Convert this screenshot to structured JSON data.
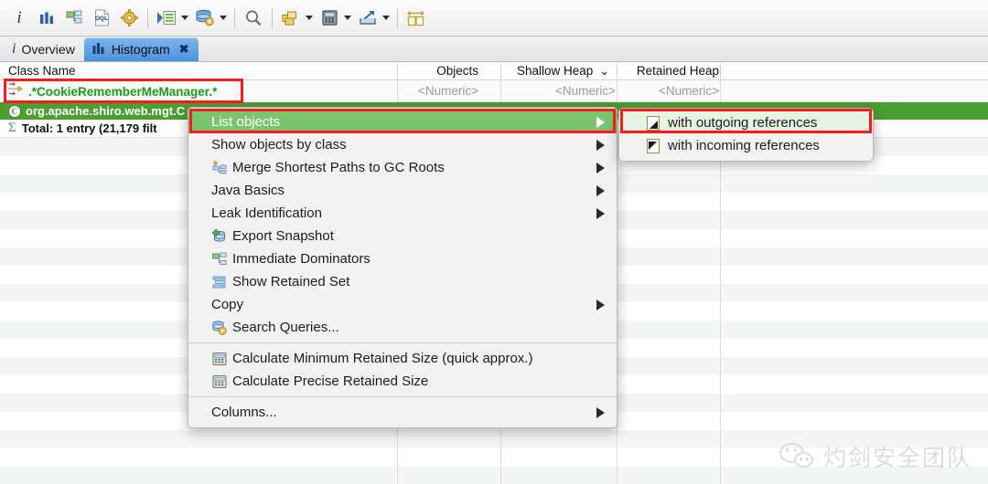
{
  "toolbar": {
    "buttons": [
      {
        "name": "info-icon",
        "label": "i"
      },
      {
        "name": "histogram-icon",
        "label": "Histogram"
      },
      {
        "name": "dominator-tree-icon",
        "label": "Dominator Tree"
      },
      {
        "name": "oql-icon",
        "label": "OQL"
      },
      {
        "name": "thread-overview-icon",
        "label": "Thread Overview"
      },
      {
        "name": "run-expert-system-icon",
        "label": "Run Expert System Test"
      },
      {
        "name": "query-browser-icon",
        "label": "Query Browser"
      },
      {
        "name": "find-icon",
        "label": "Find"
      },
      {
        "name": "group-by-icon",
        "label": "Group By"
      },
      {
        "name": "calculator-icon",
        "label": "Calculate Retained Size"
      },
      {
        "name": "export-icon",
        "label": "Export"
      },
      {
        "name": "compare-icon",
        "label": "Compare"
      }
    ]
  },
  "tabs": [
    {
      "label": "Overview",
      "icon": "info-icon",
      "active": false,
      "closable": false
    },
    {
      "label": "Histogram",
      "icon": "histogram-icon",
      "active": true,
      "closable": true
    }
  ],
  "table": {
    "columns": [
      {
        "label": "Class Name",
        "align": "left"
      },
      {
        "label": "Objects",
        "align": "right"
      },
      {
        "label": "Shallow Heap",
        "align": "right",
        "sort_indicator": "⌄"
      },
      {
        "label": "Retained Heap",
        "align": "right"
      }
    ],
    "filter_row": {
      "class_name": "",
      "objects": "<Numeric>",
      "shallow_heap": "<Numeric>",
      "retained_heap": "<Numeric>"
    },
    "regex_row": {
      "text": ".*CookieRememberMeManager.*",
      "icon": "regex-filter-icon"
    },
    "selected_row": {
      "text": "org.apache.shiro.web.mgt.C",
      "icon": "class-icon"
    },
    "total_row": {
      "text": "Total: 1 entry (21,179 filt",
      "icon": "sum-icon"
    }
  },
  "context_menu": {
    "items": [
      {
        "label": "List objects",
        "icon": null,
        "submenu": true,
        "highlighted": true
      },
      {
        "label": "Show objects by class",
        "icon": null,
        "submenu": true,
        "highlighted": false
      },
      {
        "label": "Merge Shortest Paths to GC Roots",
        "icon": "gc-roots-icon",
        "submenu": true,
        "highlighted": false
      },
      {
        "label": "Java Basics",
        "icon": null,
        "submenu": true,
        "highlighted": false
      },
      {
        "label": "Leak Identification",
        "icon": null,
        "submenu": true,
        "highlighted": false
      },
      {
        "label": "Export Snapshot",
        "icon": "export-snapshot-icon",
        "submenu": false,
        "highlighted": false
      },
      {
        "label": "Immediate Dominators",
        "icon": "dominators-icon",
        "submenu": false,
        "highlighted": false
      },
      {
        "label": "Show Retained Set",
        "icon": "retained-set-icon",
        "submenu": false,
        "highlighted": false
      },
      {
        "label": "Copy",
        "icon": null,
        "submenu": true,
        "highlighted": false
      },
      {
        "label": "Search Queries...",
        "icon": "search-queries-icon",
        "submenu": false,
        "highlighted": false
      },
      {
        "separator": true
      },
      {
        "label": "Calculate Minimum Retained Size (quick approx.)",
        "icon": "calculator-icon",
        "submenu": false,
        "highlighted": false
      },
      {
        "label": "Calculate Precise Retained Size",
        "icon": "calculator-icon",
        "submenu": false,
        "highlighted": false
      },
      {
        "separator": true
      },
      {
        "label": "Columns...",
        "icon": null,
        "submenu": true,
        "highlighted": false
      }
    ]
  },
  "submenu": {
    "items": [
      {
        "label": "with outgoing references",
        "icon": "outgoing-refs-icon",
        "highlighted": true
      },
      {
        "label": "with incoming references",
        "icon": "incoming-refs-icon",
        "highlighted": false
      }
    ]
  },
  "watermark": {
    "text": "灼剑安全团队",
    "icon": "wechat-icon"
  },
  "colors": {
    "selection_green": "#4a9e32",
    "menu_highlight_green": "#7ac46f",
    "annotation_red": "#f71b1b",
    "regex_text_green": "#16a016",
    "tab_active_blue": "#4a92dd"
  }
}
